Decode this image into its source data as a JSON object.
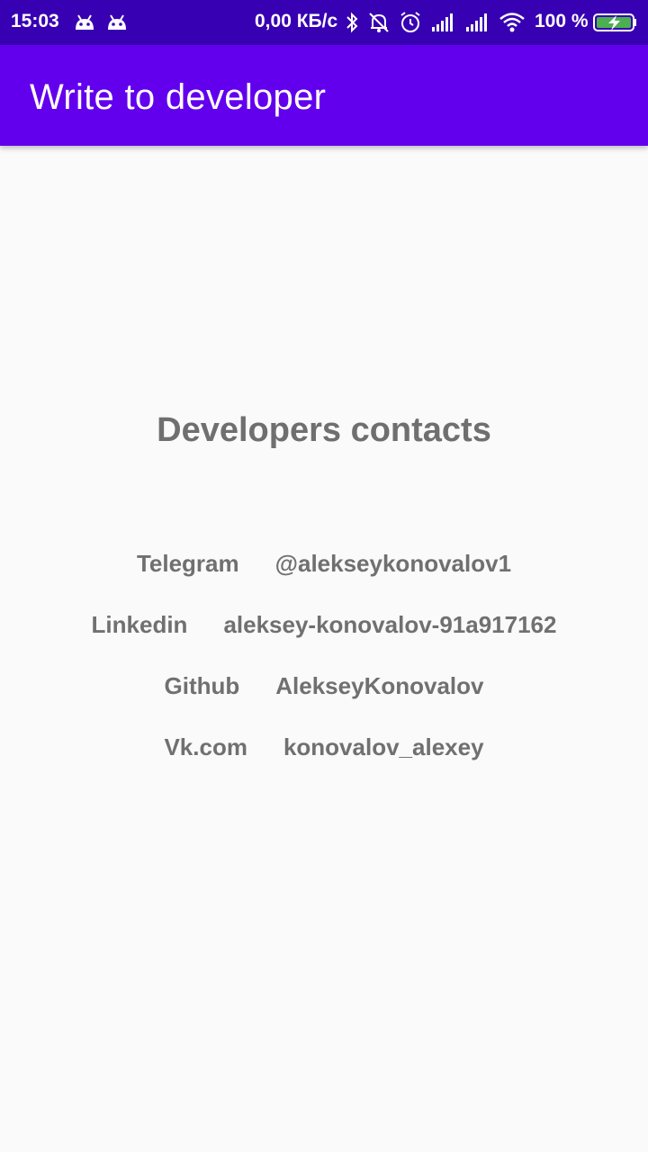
{
  "status_bar": {
    "time": "15:03",
    "speed": "0,00 КБ/с",
    "battery_text": "100 %",
    "icons": [
      "android-notification-icon",
      "android-notification-icon",
      "bluetooth-icon",
      "bell-off-icon",
      "alarm-icon",
      "cell-signal-icon",
      "cell-signal-icon",
      "wifi-icon",
      "battery-charging-icon"
    ]
  },
  "app_bar": {
    "title": "Write to developer"
  },
  "content": {
    "heading": "Developers contacts",
    "contacts": [
      {
        "label": "Telegram",
        "value": "@alekseykonovalov1"
      },
      {
        "label": "Linkedin",
        "value": "aleksey-konovalov-91a917162"
      },
      {
        "label": "Github",
        "value": "AlekseyKonovalov"
      },
      {
        "label": "Vk.com",
        "value": "konovalov_alexey"
      }
    ]
  },
  "colors": {
    "status_bar": "#3700b3",
    "app_bar": "#6200ee",
    "background": "#fafafa",
    "text": "#707070",
    "battery_fill": "#4caf50"
  }
}
